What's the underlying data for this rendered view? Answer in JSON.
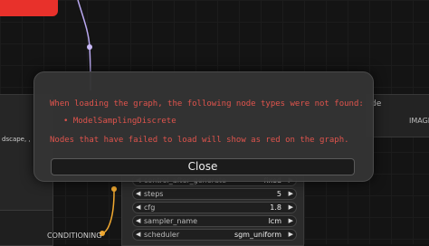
{
  "dialog": {
    "message": "When loading the graph, the following node types were not found:",
    "missing_nodes": [
      "ModelSamplingDiscrete"
    ],
    "footer": "Nodes that have failed to load will show as red on the graph.",
    "close_label": "Close"
  },
  "background": {
    "left_node_fragment": "dscape, ,",
    "right_node_title_fragment": "de",
    "right_node_output": "IMAGE",
    "conditioning_label": "CONDITIONING",
    "sampler_widgets": [
      {
        "label": "control_after_generate",
        "value": "fixed"
      },
      {
        "label": "steps",
        "value": "5"
      },
      {
        "label": "cfg",
        "value": "1.8"
      },
      {
        "label": "sampler_name",
        "value": "lcm"
      },
      {
        "label": "scheduler",
        "value": "sgm_uniform"
      }
    ]
  },
  "colors": {
    "error_text": "#e0544d",
    "red_node": "#e8312b",
    "wire_purple": "#b9a8f0",
    "wire_orange": "#f0a830"
  }
}
